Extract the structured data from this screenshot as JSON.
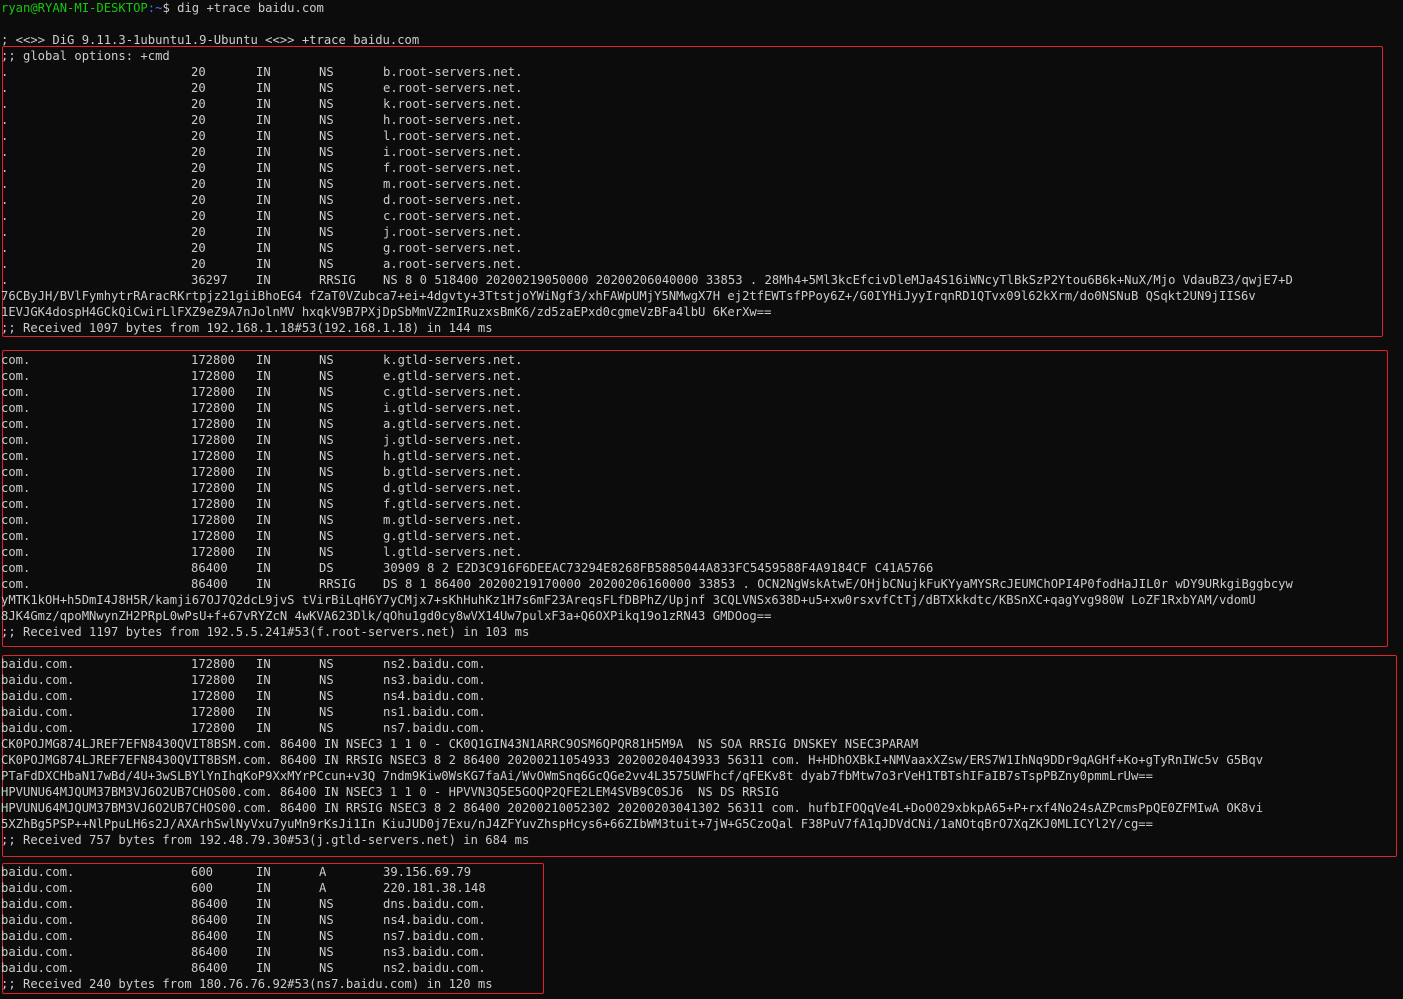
{
  "prompt": {
    "user": "ryan@RYAN-MI-DESKTOP",
    "path": ":~",
    "symbol": "$ ",
    "command": "dig +trace baidu.com"
  },
  "header_lines": [
    "; <<>> DiG 9.11.3-1ubuntu1.9-Ubuntu <<>> +trace baidu.com",
    ";; global options: +cmd"
  ],
  "sections": [
    {
      "records": [
        [
          ".",
          "20",
          "IN",
          "NS",
          "b.root-servers.net."
        ],
        [
          ".",
          "20",
          "IN",
          "NS",
          "e.root-servers.net."
        ],
        [
          ".",
          "20",
          "IN",
          "NS",
          "k.root-servers.net."
        ],
        [
          ".",
          "20",
          "IN",
          "NS",
          "h.root-servers.net."
        ],
        [
          ".",
          "20",
          "IN",
          "NS",
          "l.root-servers.net."
        ],
        [
          ".",
          "20",
          "IN",
          "NS",
          "i.root-servers.net."
        ],
        [
          ".",
          "20",
          "IN",
          "NS",
          "f.root-servers.net."
        ],
        [
          ".",
          "20",
          "IN",
          "NS",
          "m.root-servers.net."
        ],
        [
          ".",
          "20",
          "IN",
          "NS",
          "d.root-servers.net."
        ],
        [
          ".",
          "20",
          "IN",
          "NS",
          "c.root-servers.net."
        ],
        [
          ".",
          "20",
          "IN",
          "NS",
          "j.root-servers.net."
        ],
        [
          ".",
          "20",
          "IN",
          "NS",
          "g.root-servers.net."
        ],
        [
          ".",
          "20",
          "IN",
          "NS",
          "a.root-servers.net."
        ],
        [
          ".",
          "36297",
          "IN",
          "RRSIG",
          "NS 8 0 518400 20200219050000 20200206040000 33853 . 28Mh4+5Ml3kcEfcivDleMJa4S16iWNcyTlBkSzP2Ytou6B6k+NuX/Mjo VdauBZ3/qwjE7+D"
        ]
      ],
      "raw_lines": [
        "76CByJH/BVlFymhytrRAracRKrtpjz21giiBhoEG4 fZaT0VZubca7+ei+4dgvty+3TtstjoYWiNgf3/xhFAWpUMjY5NMwgX7H ej2tfEWTsfPPoy6Z+/G0IYHiJyyIrqnRD1QTvx09l62kXrm/do0NSNuB QSqkt2UN9jIIS6v",
        "1EVJGK4dospH4GCkQiCwirLlFXZ9eZ9A7nJolnMV hxqkV9B7PXjDpSbMmVZ2mIRuzxsBmK6/zd5zaEPxd0cgmeVzBFa4lbU 6KerXw=="
      ],
      "received": ";; Received 1097 bytes from 192.168.1.18#53(192.168.1.18) in 144 ms"
    },
    {
      "records": [
        [
          "com.",
          "172800",
          "IN",
          "NS",
          "k.gtld-servers.net."
        ],
        [
          "com.",
          "172800",
          "IN",
          "NS",
          "e.gtld-servers.net."
        ],
        [
          "com.",
          "172800",
          "IN",
          "NS",
          "c.gtld-servers.net."
        ],
        [
          "com.",
          "172800",
          "IN",
          "NS",
          "i.gtld-servers.net."
        ],
        [
          "com.",
          "172800",
          "IN",
          "NS",
          "a.gtld-servers.net."
        ],
        [
          "com.",
          "172800",
          "IN",
          "NS",
          "j.gtld-servers.net."
        ],
        [
          "com.",
          "172800",
          "IN",
          "NS",
          "h.gtld-servers.net."
        ],
        [
          "com.",
          "172800",
          "IN",
          "NS",
          "b.gtld-servers.net."
        ],
        [
          "com.",
          "172800",
          "IN",
          "NS",
          "d.gtld-servers.net."
        ],
        [
          "com.",
          "172800",
          "IN",
          "NS",
          "f.gtld-servers.net."
        ],
        [
          "com.",
          "172800",
          "IN",
          "NS",
          "m.gtld-servers.net."
        ],
        [
          "com.",
          "172800",
          "IN",
          "NS",
          "g.gtld-servers.net."
        ],
        [
          "com.",
          "172800",
          "IN",
          "NS",
          "l.gtld-servers.net."
        ],
        [
          "com.",
          "86400",
          "IN",
          "DS",
          "30909 8 2 E2D3C916F6DEEAC73294E8268FB5885044A833FC5459588F4A9184CF C41A5766"
        ],
        [
          "com.",
          "86400",
          "IN",
          "RRSIG",
          "DS 8 1 86400 20200219170000 20200206160000 33853 . OCN2NgWskAtwE/OHjbCNujkFuKYyaMYSRcJEUMChOPI4P0fodHaJIL0r wDY9URkgiBggbcyw"
        ]
      ],
      "raw_lines": [
        "yMTK1kOH+h5DmI4J8H5R/kamji67OJ7Q2dcL9jvS tVirBiLqH6Y7yCMjx7+sKhHuhKz1H7s6mF23AreqsFLfDBPhZ/Upjnf 3CQLVNSx638D+u5+xw0rsxvfCtTj/dBTXkkdtc/KBSnXC+qagYvg980W LoZF1RxbYAM/vdomU",
        "8JK4Gmz/qpoMNwynZH2PRpL0wPsU+f+67vRYZcN 4wKVA623Dlk/qOhu1gd0cy8wVX14Uw7pulxF3a+Q6OXPikq19o1zRN43 GMDOog=="
      ],
      "received": ";; Received 1197 bytes from 192.5.5.241#53(f.root-servers.net) in 103 ms"
    },
    {
      "records": [
        [
          "baidu.com.",
          "172800",
          "IN",
          "NS",
          "ns2.baidu.com."
        ],
        [
          "baidu.com.",
          "172800",
          "IN",
          "NS",
          "ns3.baidu.com."
        ],
        [
          "baidu.com.",
          "172800",
          "IN",
          "NS",
          "ns4.baidu.com."
        ],
        [
          "baidu.com.",
          "172800",
          "IN",
          "NS",
          "ns1.baidu.com."
        ],
        [
          "baidu.com.",
          "172800",
          "IN",
          "NS",
          "ns7.baidu.com."
        ]
      ],
      "raw_lines": [
        "CK0POJMG874LJREF7EFN8430QVIT8BSM.com. 86400 IN NSEC3 1 1 0 - CK0Q1GIN43N1ARRC9OSM6QPQR81H5M9A  NS SOA RRSIG DNSKEY NSEC3PARAM",
        "CK0POJMG874LJREF7EFN8430QVIT8BSM.com. 86400 IN RRSIG NSEC3 8 2 86400 20200211054933 20200204043933 56311 com. H+HDhOXBkI+NMVaaxXZsw/ERS7W1IhNq9DDr9qAGHf+Ko+gTyRnIWc5v G5Bqv",
        "PTaFdDXCHbaN17wBd/4U+3wSLBYlYnIhqKoP9XxMYrPCcun+v3Q 7ndm9Kiw0WsKG7faAi/WvOWmSnq6GcQGe2vv4L3575UWFhcf/qFEKv8t dyab7fbMtw7o3rVeH1TBTshIFaIB7sTspPBZny0pmmLrUw==",
        "HPVUNU64MJQUM37BM3VJ6O2UB7CHOS00.com. 86400 IN NSEC3 1 1 0 - HPVVN3Q5E5GOQP2QFE2LEM4SVB9C0SJ6  NS DS RRSIG",
        "HPVUNU64MJQUM37BM3VJ6O2UB7CHOS00.com. 86400 IN RRSIG NSEC3 8 2 86400 20200210052302 20200203041302 56311 com. hufbIFOQqVe4L+DoO029xbkpA65+P+rxf4No24sAZPcmsPpQE0ZFMIwA OK8vi",
        "5XZhBg5PSP++NlPpuLH6s2J/AXArhSwlNyVxu7yuMn9rKsJi1In KiuJUD0j7Exu/nJ4ZFYuvZhspHcys6+66ZIbWM3tuit+7jW+G5CzoQal F38PuV7fA1qJDVdCNi/1aNOtqBrO7XqZKJ0MLICYl2Y/cg=="
      ],
      "received": ";; Received 757 bytes from 192.48.79.30#53(j.gtld-servers.net) in 684 ms"
    },
    {
      "records": [
        [
          "baidu.com.",
          "600",
          "IN",
          "A",
          "39.156.69.79"
        ],
        [
          "baidu.com.",
          "600",
          "IN",
          "A",
          "220.181.38.148"
        ],
        [
          "baidu.com.",
          "86400",
          "IN",
          "NS",
          "dns.baidu.com."
        ],
        [
          "baidu.com.",
          "86400",
          "IN",
          "NS",
          "ns4.baidu.com."
        ],
        [
          "baidu.com.",
          "86400",
          "IN",
          "NS",
          "ns7.baidu.com."
        ],
        [
          "baidu.com.",
          "86400",
          "IN",
          "NS",
          "ns3.baidu.com."
        ],
        [
          "baidu.com.",
          "86400",
          "IN",
          "NS",
          "ns2.baidu.com."
        ]
      ],
      "raw_lines": [],
      "received": ";; Received 240 bytes from 180.76.76.92#53(ns7.baidu.com) in 120 ms"
    }
  ],
  "colors": {
    "background": "#0c0c0c",
    "text": "#cccccc",
    "prompt_user": "#16c60c",
    "prompt_path": "#3b78ff",
    "highlight_box": "#e0232b"
  }
}
